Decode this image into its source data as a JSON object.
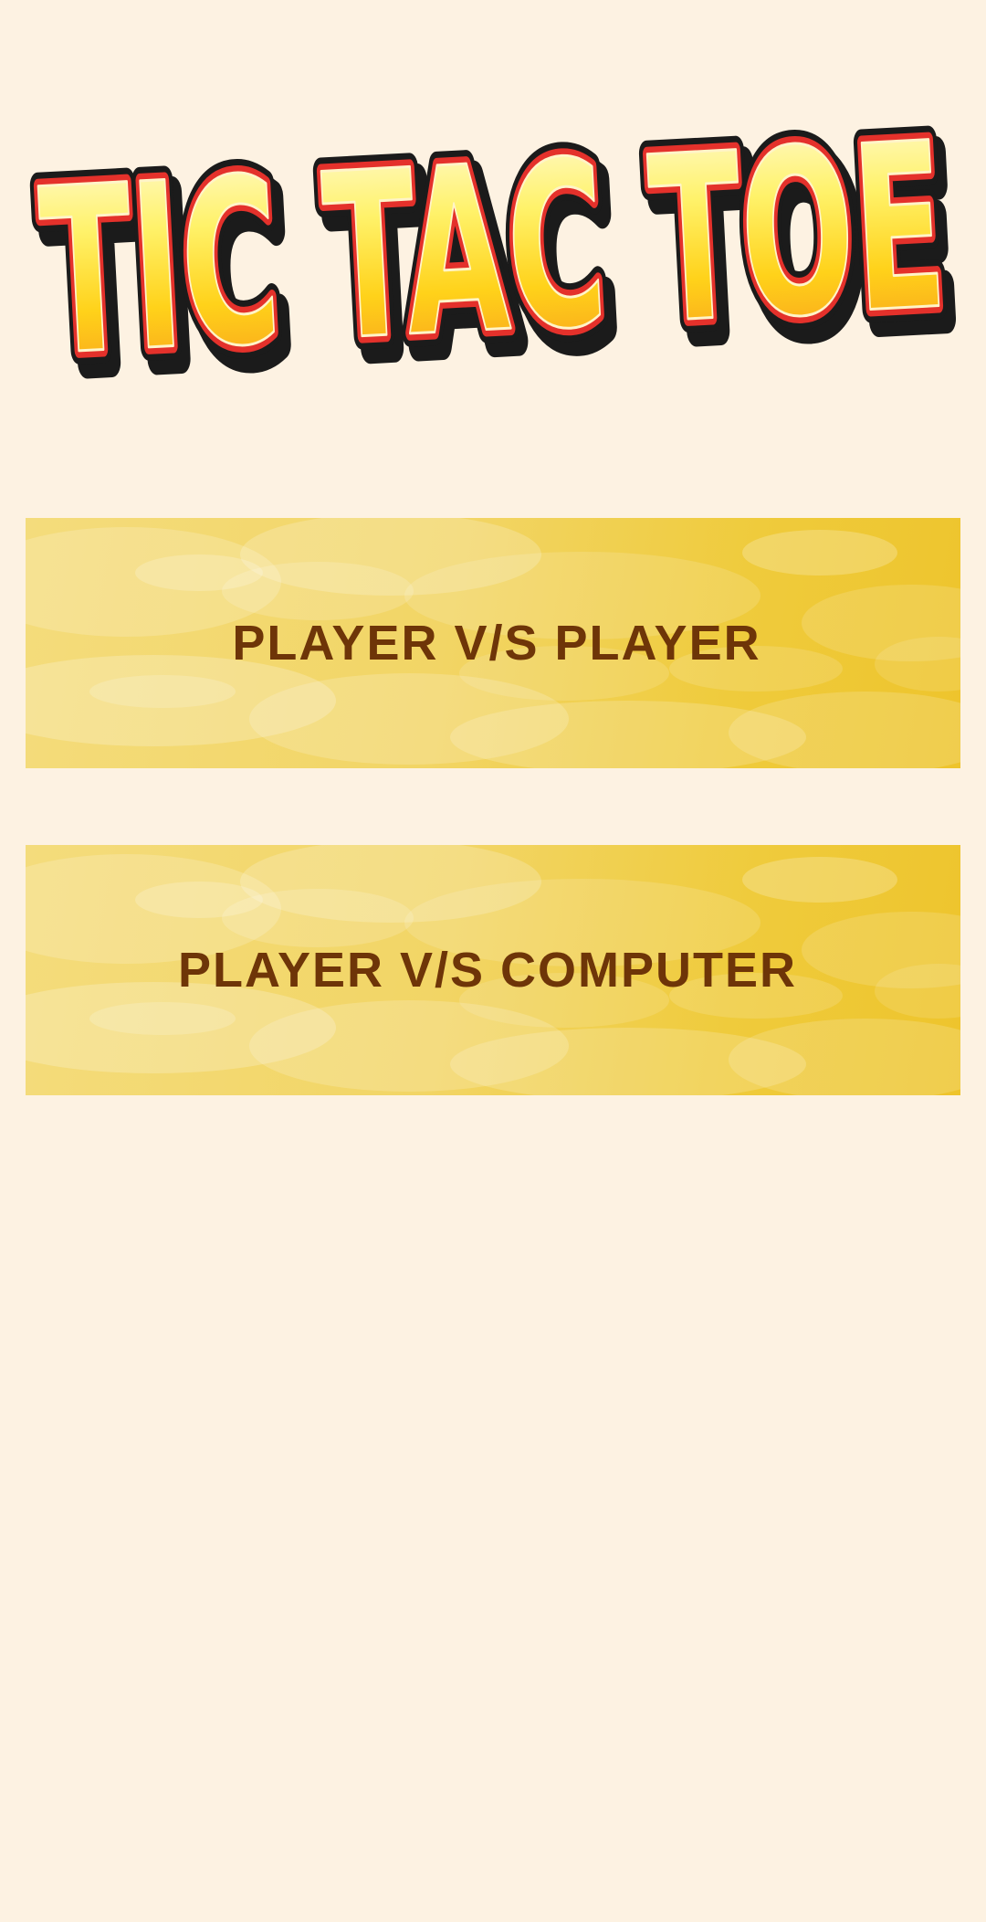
{
  "app": {
    "logo_text": "TIC TAC TOE"
  },
  "menu": {
    "player_vs_player_label": "PLAYER V/S PLAYER",
    "player_vs_computer_label": "PLAYER V/S COMPUTER"
  },
  "colors": {
    "background": "#fdf2e2",
    "button_text": "#6e3508",
    "button_gold": "#efcb3c",
    "logo_fill_top": "#fffbe0",
    "logo_fill_bottom": "#f7941d",
    "logo_outline": "#e4312b"
  }
}
